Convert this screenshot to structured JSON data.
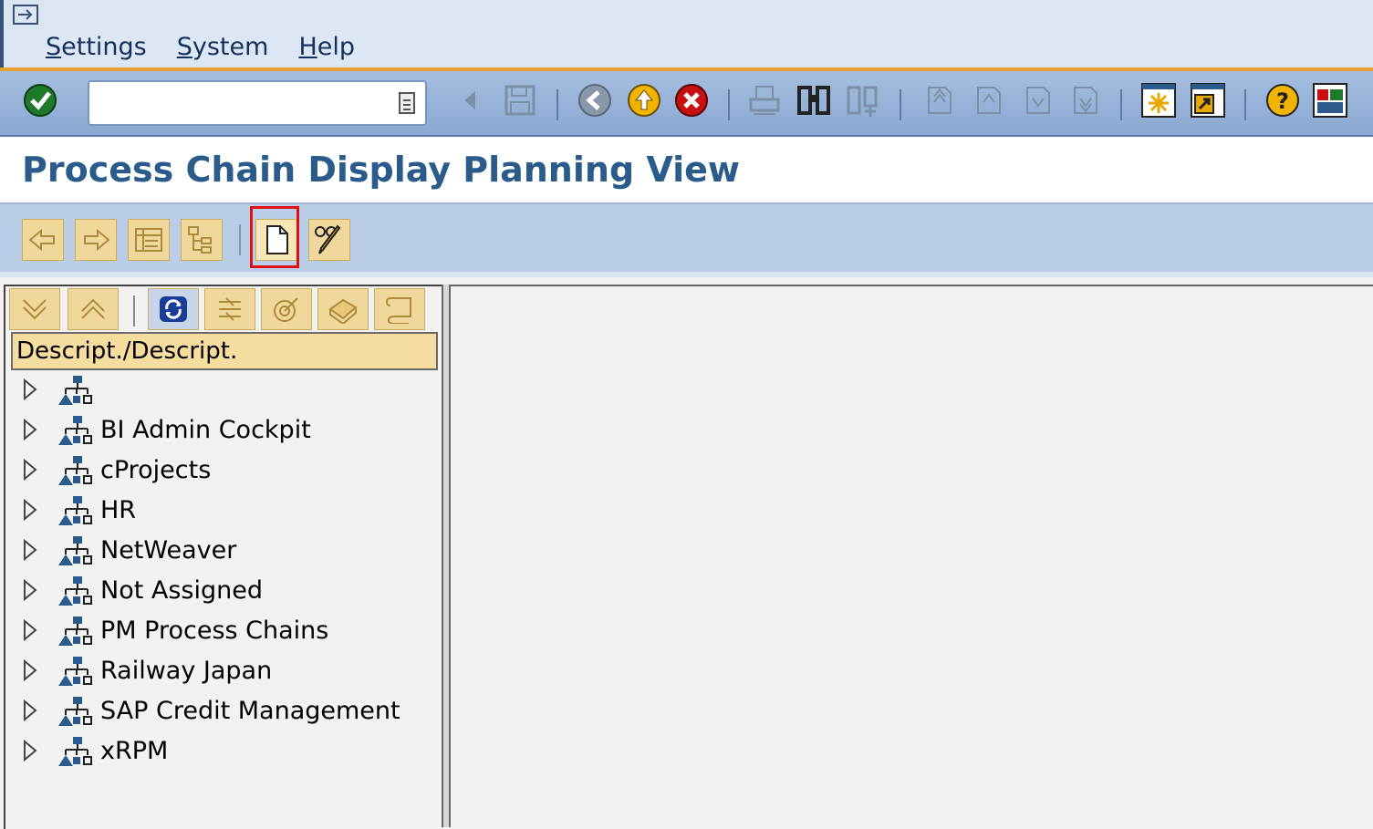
{
  "menu": {
    "items": [
      "Settings",
      "System",
      "Help"
    ]
  },
  "toolbar": {
    "command_field_value": ""
  },
  "title": "Process Chain Display Planning View",
  "tree": {
    "column_header": "Descript./Descript.",
    "items": [
      {
        "label": ""
      },
      {
        "label": "BI Admin Cockpit"
      },
      {
        "label": "cProjects"
      },
      {
        "label": "HR"
      },
      {
        "label": "NetWeaver"
      },
      {
        "label": "Not Assigned"
      },
      {
        "label": "PM Process Chains"
      },
      {
        "label": "Railway Japan"
      },
      {
        "label": "SAP Credit Management"
      },
      {
        "label": "xRPM"
      }
    ]
  },
  "colors": {
    "accent_orange": "#e9a030",
    "title_blue": "#2a5b8a",
    "button_gold": "#f0d89c",
    "highlight_red": "#e01010"
  }
}
